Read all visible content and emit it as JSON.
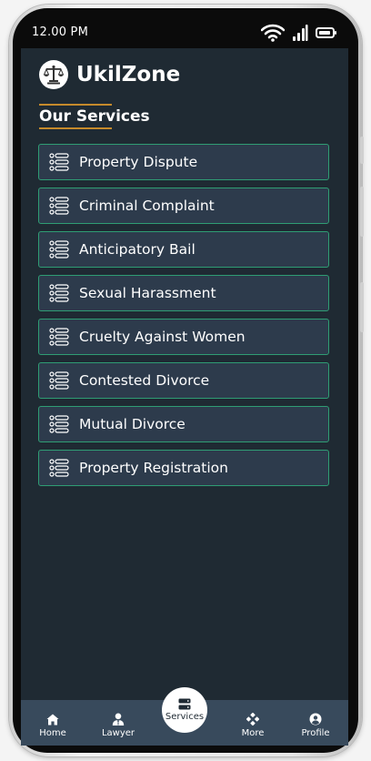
{
  "status_bar": {
    "time": "12.00 PM",
    "icons": [
      "wifi-icon",
      "signal-icon",
      "battery-icon"
    ]
  },
  "header": {
    "logo_icon": "scales-of-justice-icon",
    "title": "UkilZone"
  },
  "section": {
    "title": "Our Services",
    "accent_color": "#c58a2b"
  },
  "services": [
    {
      "label": "Property Dispute"
    },
    {
      "label": "Criminal Complaint"
    },
    {
      "label": "Anticipatory Bail"
    },
    {
      "label": "Sexual Harassment"
    },
    {
      "label": "Cruelty Against Women"
    },
    {
      "label": "Contested Divorce"
    },
    {
      "label": "Mutual Divorce"
    },
    {
      "label": "Property Registration"
    }
  ],
  "bottom_nav": {
    "items": [
      {
        "label": "Home",
        "icon": "home-icon"
      },
      {
        "label": "Lawyer",
        "icon": "lawyer-icon"
      },
      {
        "label": "Services",
        "icon": "server-icon",
        "active": true
      },
      {
        "label": "More",
        "icon": "more-icon"
      },
      {
        "label": "Profile",
        "icon": "profile-icon"
      }
    ]
  },
  "colors": {
    "background": "#1f2a33",
    "card": "#2d3b4c",
    "card_border": "#2f9d74",
    "nav": "#384a5c"
  }
}
